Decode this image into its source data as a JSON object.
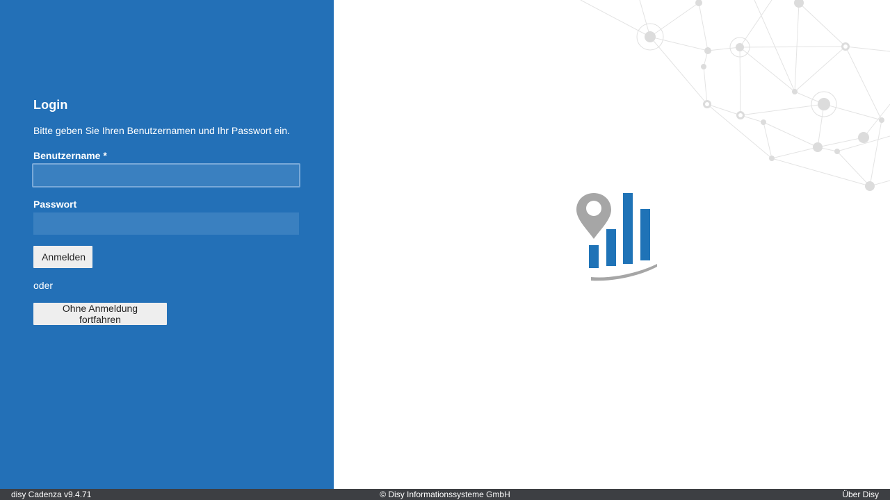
{
  "login": {
    "title": "Login",
    "description": "Bitte geben Sie Ihren Benutzernamen und Ihr Passwort ein.",
    "username_label": "Benutzername *",
    "username_value": "",
    "password_label": "Passwort",
    "password_value": "",
    "login_button": "Anmelden",
    "or_text": "oder",
    "continue_button": "Ohne Anmeldung fortfahren"
  },
  "branding": {
    "logo_icon": "map-pin-bar-chart-logo",
    "background_decoration": "network-graph"
  },
  "footer": {
    "version": "disy Cadenza v9.4.71",
    "copyright": "© Disy Informationssysteme GmbH",
    "about_link": "Über Disy"
  },
  "colors": {
    "panel_bg": "#2370b7",
    "input_bg": "#3a80c0",
    "button_bg": "#eeeeee",
    "footer_bg": "#3d3f43",
    "logo_blue": "#1f73b7",
    "logo_gray": "#a6a6a6"
  }
}
